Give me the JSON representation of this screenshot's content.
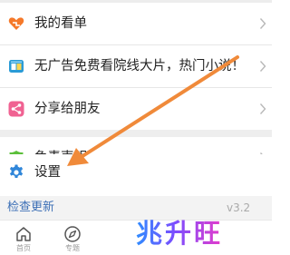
{
  "menu": {
    "items": [
      {
        "label": "我的看单",
        "icon": "heart-icon"
      },
      {
        "label": "无广告免费看院线大片，热门小说！",
        "icon": "book-icon"
      },
      {
        "label": "分享给朋友",
        "icon": "share-icon"
      },
      {
        "label": "免责声明",
        "icon": "shield-icon"
      },
      {
        "label": "设置",
        "icon": "gear-icon"
      }
    ]
  },
  "update": {
    "label": "检查更新",
    "version": "v3.2"
  },
  "tabbar": {
    "tabs": [
      {
        "label": "首页",
        "icon": "home-icon"
      },
      {
        "label": "专题",
        "icon": "compass-icon"
      }
    ]
  },
  "watermark": {
    "text": "兆升旺"
  },
  "colors": {
    "heart": "#f5792a",
    "book": "#2a9bd6",
    "share": "#f06292",
    "shield": "#5bbf3a",
    "gear": "#2f86d9",
    "arrow": "#f08a3a",
    "link": "#3c6fb6"
  }
}
